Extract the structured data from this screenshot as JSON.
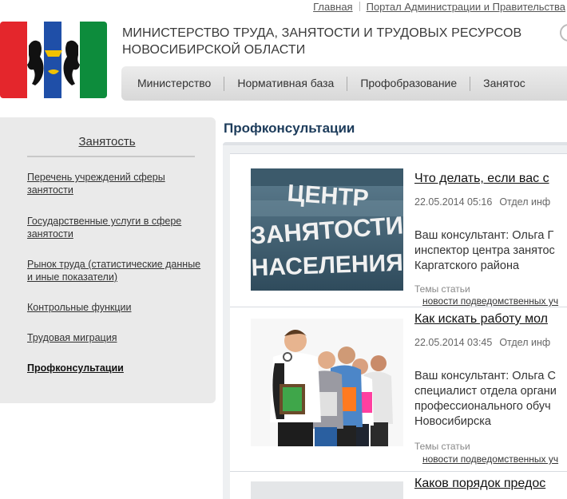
{
  "header": {
    "links": [
      "Главная",
      "Портал Администрации и Правительства"
    ],
    "ministry_line1": "МИНИСТЕРСТВО ТРУДА, ЗАНЯТОСТИ И ТРУДОВЫХ РЕСУРСОВ",
    "ministry_line2": "НОВОСИБИРСКОЙ ОБЛАСТИ",
    "logo_icon": "coat-of-arms-icon",
    "colors": {
      "logo_red": "#e4262c",
      "logo_white": "#ffffff",
      "logo_green": "#0d8c3c",
      "logo_blue": "#1f4fa8"
    }
  },
  "nav": {
    "items": [
      "Министерство",
      "Нормативная база",
      "Профобразование",
      "Занятос"
    ]
  },
  "sidebar": {
    "title": "Занятость",
    "items": [
      "Перечень учреждений сферы занятости",
      "Государственные услуги в сфере занятости",
      "Рынок труда (статистические данные и иные показатели)",
      "Контрольные функции",
      "Трудовая миграция",
      "Профконсультации"
    ]
  },
  "main": {
    "page_title": "Профконсультации",
    "articles": [
      {
        "title": "Что делать, если вас с",
        "date": "22.05.2014 05:16",
        "department": "Отдел инф",
        "body_line1": "Ваш консультант: Ольга Г",
        "body_line2": "инспектор центра занятос",
        "body_line3": "Каргатского района",
        "body_line4": "",
        "themes_label": "Темы статьи",
        "theme_link": "новости подведомственных уч",
        "sign_line1": "ЦЕНТР",
        "sign_line2": "ЗАНЯТОСТИ",
        "sign_line3": "НАСЕЛЕНИЯ"
      },
      {
        "title": "Как искать работу мол",
        "date": "22.05.2014 03:45",
        "department": "Отдел инф",
        "body_line1": "Ваш консультант: Ольга С",
        "body_line2": "специалист отдела органи",
        "body_line3": "профессионального обуч",
        "body_line4": "Новосибирска",
        "themes_label": "Темы статьи",
        "theme_link": "новости подведомственных уч"
      },
      {
        "title": "Каков порядок предос"
      }
    ]
  }
}
